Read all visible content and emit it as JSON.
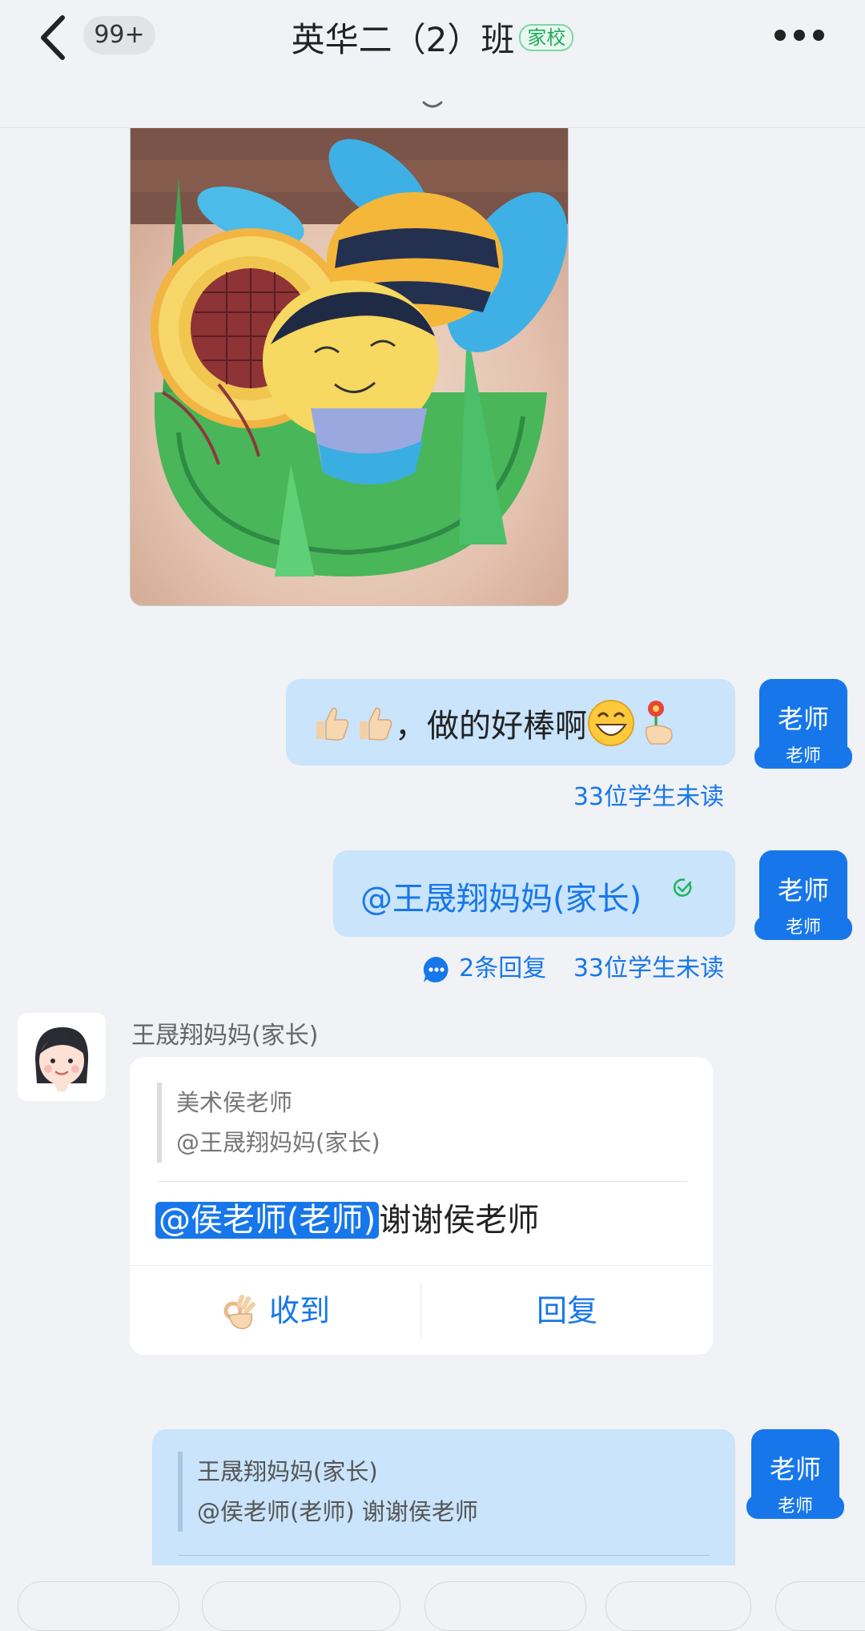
{
  "header": {
    "unread_badge": "99+",
    "title": "英华二（2）班",
    "tag": "家校"
  },
  "messages": [
    {
      "text": "，做的好棒啊",
      "avatar_name": "老师",
      "avatar_role": "老师",
      "unread": "33位学生未读"
    },
    {
      "text": "@王晟翔妈妈(家长)",
      "avatar_name": "老师",
      "avatar_role": "老师",
      "replies": "2条回复",
      "unread": "33位学生未读"
    }
  ],
  "parent_message": {
    "sender": "王晟翔妈妈(家长)",
    "quote_author": "美术侯老师",
    "quote_text": "@王晟翔妈妈(家长)",
    "mention": "@侯老师(老师)",
    "text": "谢谢侯老师",
    "ack_button": "收到",
    "reply_button": "回复"
  },
  "bottom_message": {
    "quote_author": "王晟翔妈妈(家长)",
    "quote_text": "@侯老师(老师) 谢谢侯老师",
    "avatar_name": "老师",
    "avatar_role": "老师"
  },
  "colors": {
    "accent": "#1777ea",
    "bubble": "#c9e4fb",
    "background": "#f0f2f5",
    "tag_green": "#1dab5a"
  },
  "icons": [
    "back-icon",
    "more-icon",
    "collapse-icon",
    "thumbs-up-icon",
    "grin-emoji-icon",
    "flower-emoji-icon",
    "read-check-icon",
    "reply-count-icon",
    "ok-hand-icon",
    "parent-avatar-icon"
  ]
}
